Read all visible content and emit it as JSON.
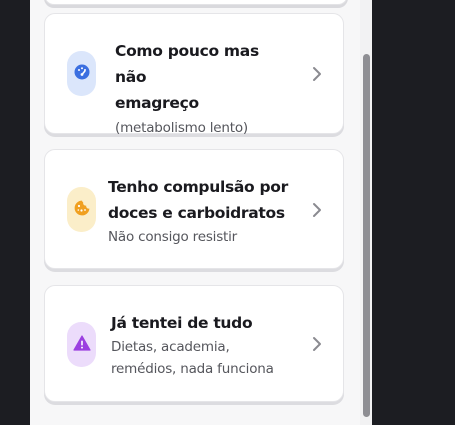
{
  "options": [
    {
      "title_lines": [
        "Como pouco mas não",
        "emagreço"
      ],
      "subtitle_lines": [
        "(metabolismo lento)"
      ],
      "icon": "gauge-icon",
      "icon_color": "#3b6fe0",
      "badge_color": "#dbe6fb"
    },
    {
      "title_lines": [
        "Tenho compulsão por",
        "doces e carboidratos"
      ],
      "subtitle_lines": [
        "Não consigo resistir"
      ],
      "icon": "cookie-icon",
      "icon_color": "#f0a020",
      "badge_color": "#fbeec9"
    },
    {
      "title_lines": [
        "Já tentei de tudo"
      ],
      "subtitle_lines": [
        "Dietas, academia,",
        "remédios, nada funciona"
      ],
      "icon": "warning-icon",
      "icon_color": "#9b3fe0",
      "badge_color": "#ecdcfb"
    }
  ],
  "colors": {
    "background": "#1c1d22",
    "panel": "#f7f7f8",
    "card": "#ffffff",
    "chevron": "#8a8a90",
    "scrollbar_thumb": "#8e8e93"
  }
}
